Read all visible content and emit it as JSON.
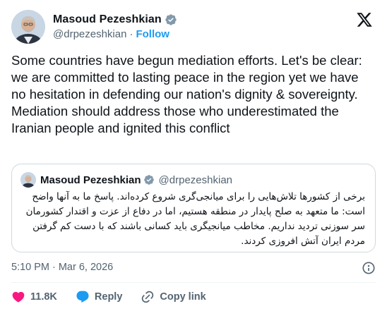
{
  "author": {
    "display_name": "Masoud Pezeshkian",
    "handle": "@drpezeshkian",
    "separator": "·",
    "follow_label": "Follow"
  },
  "tweet": {
    "text": "Some countries have begun mediation efforts. Let's be clear: we are committed to lasting peace in the region yet we have no hesitation in defending our nation's dignity & sovereignty. Mediation should address those who underestimated the Iranian people and ignited this conflict"
  },
  "quote": {
    "display_name": "Masoud Pezeshkian",
    "handle": "@drpezeshkian",
    "text": "برخی از کشورها تلاش‌هایی را برای میانجی‌گری شروع کرده‌اند. پاسخ ما به آنها واضح است: ما متعهد به صلح پایدار در منطقه هستیم، اما در دفاع از عزت و اقتدار کشورمان سر سوزنی تردید نداریم. مخاطب میانجیگری باید کسانی باشند که با دست کم گرفتن مردم ایران آتش افروزی کردند."
  },
  "meta": {
    "time": "5:10 PM",
    "separator": "·",
    "date": "Mar 6, 2026"
  },
  "actions": {
    "like_count": "11.8K",
    "reply_label": "Reply",
    "copy_link_label": "Copy link"
  },
  "colors": {
    "accent": "#1d9bf0",
    "like": "#f91880",
    "text": "#0f1419",
    "muted": "#536471",
    "border": "#cfd9de"
  },
  "icons": {
    "verified": "verified-badge-icon",
    "x_logo": "x-logo-icon",
    "info": "info-icon",
    "like": "heart-icon",
    "reply": "reply-icon",
    "copy_link": "link-icon"
  }
}
